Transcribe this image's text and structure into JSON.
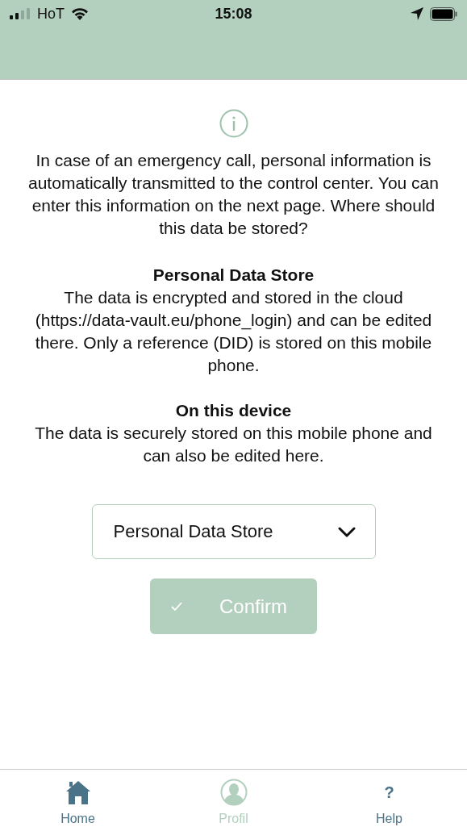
{
  "status_bar": {
    "carrier": "HoT",
    "time": "15:08"
  },
  "intro": "In case of an emergency call, personal information is automatically transmitted to the control center. You can enter this information on the next page. Where should this data be stored?",
  "options_info": [
    {
      "title": "Personal Data Store",
      "text": "The data is encrypted and stored in the cloud (https://data-vault.eu/phone_login) and can be edited there. Only a reference (DID) is stored on this mobile phone."
    },
    {
      "title": "On this device",
      "text": "The data is securely stored on this mobile phone and can also be edited here."
    }
  ],
  "storage_select": {
    "value": "Personal Data Store"
  },
  "confirm_button": {
    "label": "Confirm",
    "disabled": true
  },
  "tabs": [
    {
      "kind": "home",
      "label": "Home",
      "selected": false
    },
    {
      "kind": "profile",
      "label": "Profil",
      "selected": true
    },
    {
      "kind": "help",
      "label": "Help",
      "glyph": "?",
      "selected": false
    }
  ]
}
